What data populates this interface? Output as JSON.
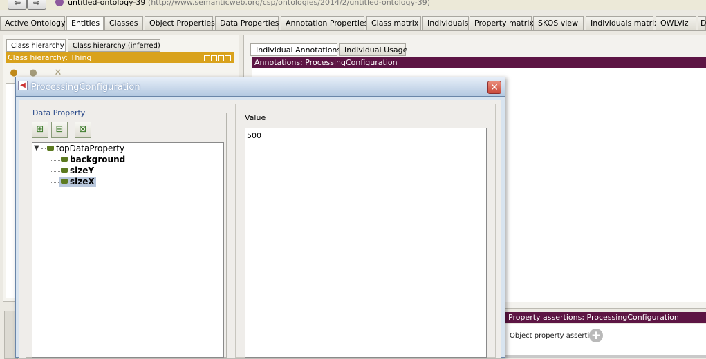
{
  "window": {
    "ontology_name": "untitled-ontology-39",
    "ontology_url": "(http://www.semanticweb.org/csp/ontologies/2014/2/untitled-ontology-39)"
  },
  "nav": {
    "back_icon": "back-arrow-icon",
    "forward_icon": "forward-arrow-icon"
  },
  "tabs": [
    {
      "label": "Active Ontology"
    },
    {
      "label": "Entities",
      "active": true
    },
    {
      "label": "Classes"
    },
    {
      "label": "Object Properties"
    },
    {
      "label": "Data Properties"
    },
    {
      "label": "Annotation Properties"
    },
    {
      "label": "Class matrix"
    },
    {
      "label": "Individuals"
    },
    {
      "label": "Property matrix"
    },
    {
      "label": "SKOS view"
    },
    {
      "label": "Individuals matrix"
    },
    {
      "label": "OWLViz"
    },
    {
      "label": "D"
    }
  ],
  "left": {
    "subtabs": [
      "Class hierarchy",
      "Class hierarchy (inferred)"
    ],
    "header": "Class hierarchy: Thing",
    "toolbar_icons": [
      "add-subclass-icon",
      "add-sibling-icon",
      "delete-class-icon"
    ]
  },
  "right": {
    "subtabs": [
      "Individual Annotations",
      "Individual Usage"
    ],
    "annotations_header": "Annotations: ProcessingConfiguration",
    "property_assertions_header": "Property assertions: ProcessingConfiguration",
    "object_property_assertions": "Object property assertions",
    "add_label": "+"
  },
  "dialog": {
    "title": "ProcessingConfiguration",
    "close_label": "✕",
    "data_property_label": "Data Property",
    "toolbar_icons": [
      "add-sub-property-icon",
      "add-sibling-property-icon",
      "delete-property-icon"
    ],
    "tree": {
      "root": "topDataProperty",
      "children": [
        "background",
        "sizeY",
        "sizeX"
      ],
      "selected": "sizeX"
    },
    "value_label": "Value",
    "value": "500"
  }
}
